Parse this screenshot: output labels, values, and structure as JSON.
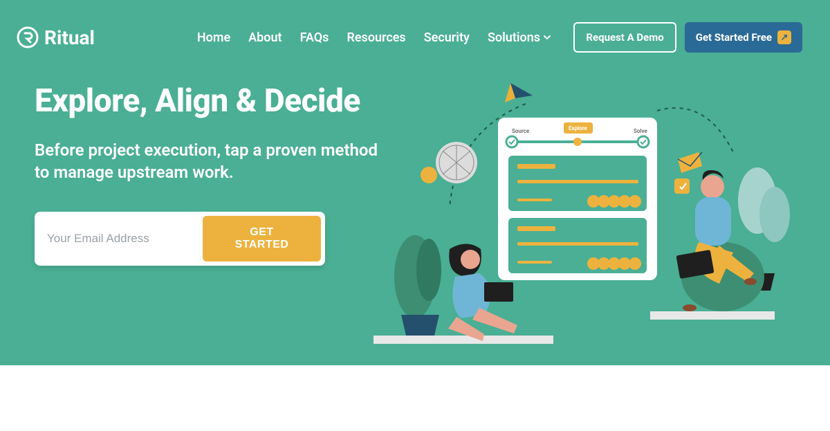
{
  "brand": {
    "name": "Ritual"
  },
  "nav": {
    "items": [
      {
        "label": "Home"
      },
      {
        "label": "About"
      },
      {
        "label": "FAQs"
      },
      {
        "label": "Resources"
      },
      {
        "label": "Security"
      },
      {
        "label": "Solutions"
      }
    ],
    "demo_label": "Request A Demo",
    "get_started_label": "Get Started Free"
  },
  "hero": {
    "headline": "Explore, Align & Decide",
    "sublead": "Before project execution, tap a proven method to manage upstream work.",
    "email_placeholder": "Your Email Address",
    "cta_label": "GET STARTED"
  },
  "illustration": {
    "card_left_label": "Source",
    "card_center_label": "Explore",
    "card_right_label": "Solve"
  },
  "colors": {
    "bg": "#4aaf94",
    "accent": "#edb23e",
    "primary_btn": "#2a6a96"
  }
}
